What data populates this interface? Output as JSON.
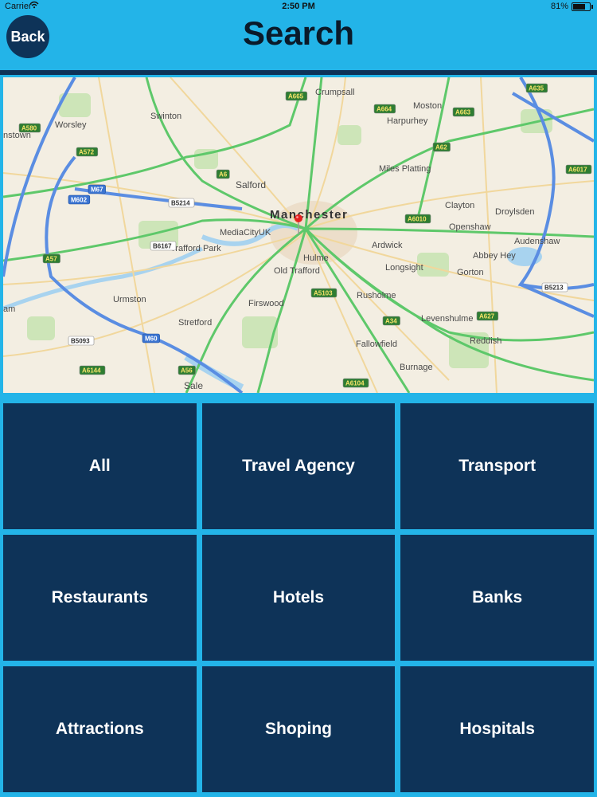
{
  "status_bar": {
    "carrier": "Carrier",
    "time": "2:50 PM",
    "battery": "81%",
    "battery_level": 0.81
  },
  "header": {
    "title": "Search",
    "back_label": "Back"
  },
  "colors": {
    "background": "#23b4e8",
    "tile": "#0e3358",
    "tile_text": "#ffffff",
    "title_text": "#0a1a2a"
  },
  "map": {
    "city": "Manchester",
    "places": [
      "Crumpsall",
      "Swinton",
      "Worsley",
      "Moston",
      "Harpurhey",
      "Salford",
      "Miles Platting",
      "Clayton",
      "Droylsden",
      "MediaCityUK",
      "Trafford Park",
      "Openshaw",
      "Ardwick",
      "Hulme",
      "Old Trafford",
      "Longsight",
      "Abbey Hey",
      "Audenshaw",
      "Gorton",
      "Urmston",
      "Firswood",
      "Rusholme",
      "Levenshulme",
      "Stretford",
      "Fallowfield",
      "Reddish",
      "Burnage",
      "Sale",
      "nstown",
      "am"
    ],
    "roads": [
      "A6",
      "A56",
      "A57",
      "A580",
      "A572",
      "A665",
      "A664",
      "A663",
      "A62",
      "A6010",
      "A5103",
      "A34",
      "A6144",
      "M60",
      "M602",
      "M67",
      "B5214",
      "B5213",
      "B6167",
      "B5093",
      "A627",
      "A6104",
      "A6017",
      "A635"
    ]
  },
  "categories": [
    "All",
    "Travel Agency",
    "Transport",
    "Restaurants",
    "Hotels",
    "Banks",
    "Attractions",
    "Shoping",
    "Hospitals"
  ]
}
